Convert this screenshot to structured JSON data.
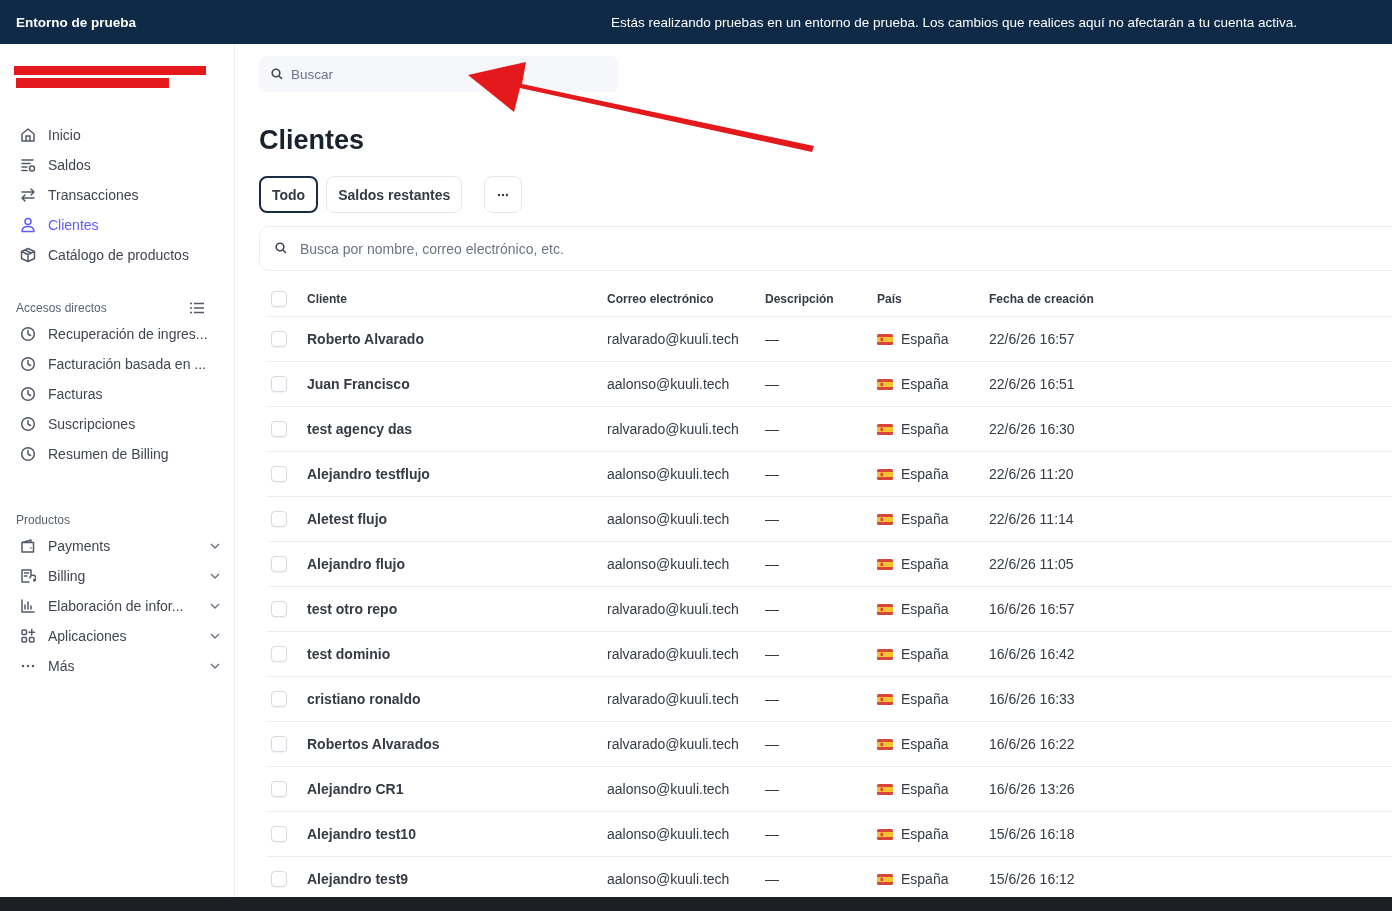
{
  "banner": {
    "title": "Entorno de prueba",
    "message": "Estás realizando pruebas en un entorno de prueba. Los cambios que realices aquí no afectarán a tu cuenta activa."
  },
  "sidebar": {
    "nav": [
      {
        "label": "Inicio",
        "kind": "home",
        "selected": false
      },
      {
        "label": "Saldos",
        "kind": "balances",
        "selected": false
      },
      {
        "label": "Transacciones",
        "kind": "transfer",
        "selected": false
      },
      {
        "label": "Clientes",
        "kind": "person",
        "selected": true
      },
      {
        "label": "Catálogo de productos",
        "kind": "box",
        "selected": false
      }
    ],
    "shortcuts": {
      "title": "Accesos directos",
      "items": [
        "Recuperación de ingres...",
        "Facturación basada en ...",
        "Facturas",
        "Suscripciones",
        "Resumen de Billing"
      ]
    },
    "products": {
      "title": "Productos",
      "items": [
        {
          "label": "Payments",
          "kind": "wallet",
          "expanded": false
        },
        {
          "label": "Billing",
          "kind": "receipt",
          "expanded": false
        },
        {
          "label": "Elaboración de infor...",
          "kind": "chart",
          "expanded": false
        },
        {
          "label": "Aplicaciones",
          "kind": "apps",
          "expanded": false
        },
        {
          "label": "Más",
          "kind": "dots",
          "expanded": false
        }
      ]
    }
  },
  "search": {
    "placeholder": "Buscar"
  },
  "page_title": "Clientes",
  "filters": [
    {
      "label": "Todo",
      "selected": true
    },
    {
      "label": "Saldos restantes",
      "selected": false
    }
  ],
  "table": {
    "search_placeholder": "Busca por nombre, correo electrónico, etc.",
    "all_checked": false,
    "columns": [
      "Cliente",
      "Correo electrónico",
      "Descripción",
      "País",
      "Fecha de creación"
    ],
    "rows": [
      {
        "cells": [
          "Roberto Alvarado",
          "ralvarado@kuuli.tech",
          "—",
          "España",
          "22/6/26 16:57"
        ],
        "checked": false
      },
      {
        "cells": [
          "Juan Francisco",
          "aalonso@kuuli.tech",
          "—",
          "España",
          "22/6/26 16:51"
        ],
        "checked": false
      },
      {
        "cells": [
          "test agency das",
          "ralvarado@kuuli.tech",
          "—",
          "España",
          "22/6/26 16:30"
        ],
        "checked": false
      },
      {
        "cells": [
          "Alejandro testflujo",
          "aalonso@kuuli.tech",
          "—",
          "España",
          "22/6/26 11:20"
        ],
        "checked": false
      },
      {
        "cells": [
          "Aletest flujo",
          "aalonso@kuuli.tech",
          "—",
          "España",
          "22/6/26 11:14"
        ],
        "checked": false
      },
      {
        "cells": [
          "Alejandro flujo",
          "aalonso@kuuli.tech",
          "—",
          "España",
          "22/6/26 11:05"
        ],
        "checked": false
      },
      {
        "cells": [
          "test otro repo",
          "ralvarado@kuuli.tech",
          "—",
          "España",
          "16/6/26 16:57"
        ],
        "checked": false
      },
      {
        "cells": [
          "test dominio",
          "ralvarado@kuuli.tech",
          "—",
          "España",
          "16/6/26 16:42"
        ],
        "checked": false
      },
      {
        "cells": [
          "cristiano ronaldo",
          "ralvarado@kuuli.tech",
          "—",
          "España",
          "16/6/26 16:33"
        ],
        "checked": false
      },
      {
        "cells": [
          "Robertos Alvarados",
          "ralvarado@kuuli.tech",
          "—",
          "España",
          "16/6/26 16:22"
        ],
        "checked": false
      },
      {
        "cells": [
          "Alejandro CR1",
          "aalonso@kuuli.tech",
          "—",
          "España",
          "16/6/26 13:26"
        ],
        "checked": false
      },
      {
        "cells": [
          "Alejandro test10",
          "aalonso@kuuli.tech",
          "—",
          "España",
          "15/6/26 16:18"
        ],
        "checked": false
      },
      {
        "cells": [
          "Alejandro test9",
          "aalonso@kuuli.tech",
          "—",
          "España",
          "15/6/26 16:12"
        ],
        "checked": false
      }
    ]
  }
}
